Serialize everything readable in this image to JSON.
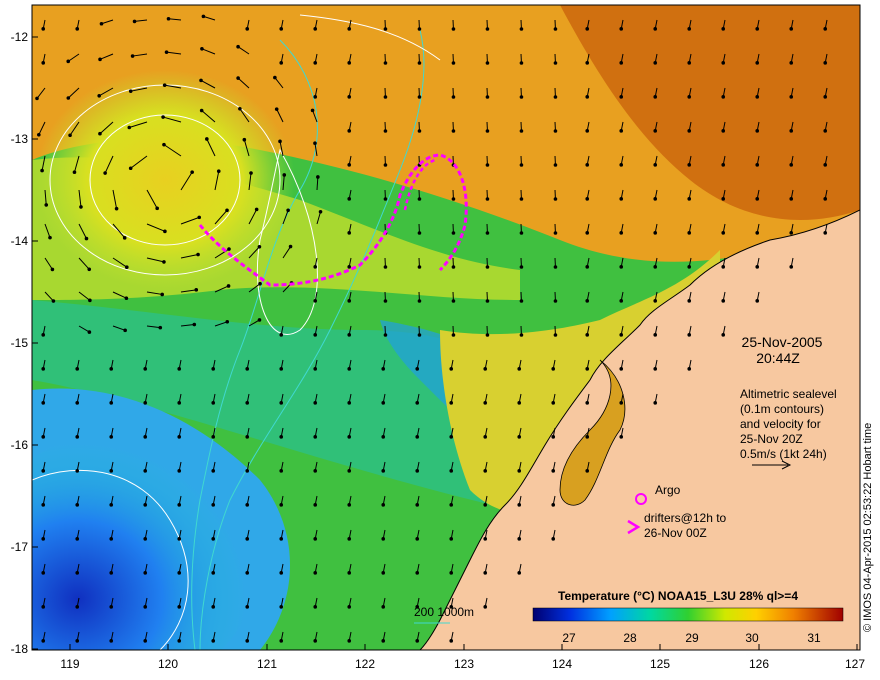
{
  "map": {
    "x_ticks": [
      "119",
      "120",
      "121",
      "122",
      "123",
      "124",
      "125",
      "126",
      "127"
    ],
    "y_ticks": [
      "-12",
      "-13",
      "-14",
      "-15",
      "-16",
      "-17",
      "-18"
    ],
    "date": "25-Nov-2005",
    "time": "20:44Z",
    "altimetry_note": [
      "Altimetric sealevel",
      "(0.1m contours)",
      "and velocity for",
      "25-Nov 20Z",
      "0.5m/s (1kt 24h)"
    ],
    "argo_label": "Argo",
    "drifters_label": [
      "drifters@12h to",
      "26-Nov 00Z"
    ],
    "colorbar_title": "Temperature (°C) NOAA15_L3U 28% ql>=4",
    "colorbar_ticks": [
      "27",
      "28",
      "29",
      "30",
      "31"
    ],
    "depth_legend": "200  1000m",
    "credit": "© IMOS 04-Apr-2015 02:53:22 Hobart time"
  },
  "colors": {
    "land": "#f7c8a0",
    "cold": "#1e2fb0",
    "mid": "#21c040",
    "warm": "#f0a000",
    "hot": "#c03000",
    "drifter": "#ff00ff",
    "bathymetry": "#40d8d0"
  }
}
